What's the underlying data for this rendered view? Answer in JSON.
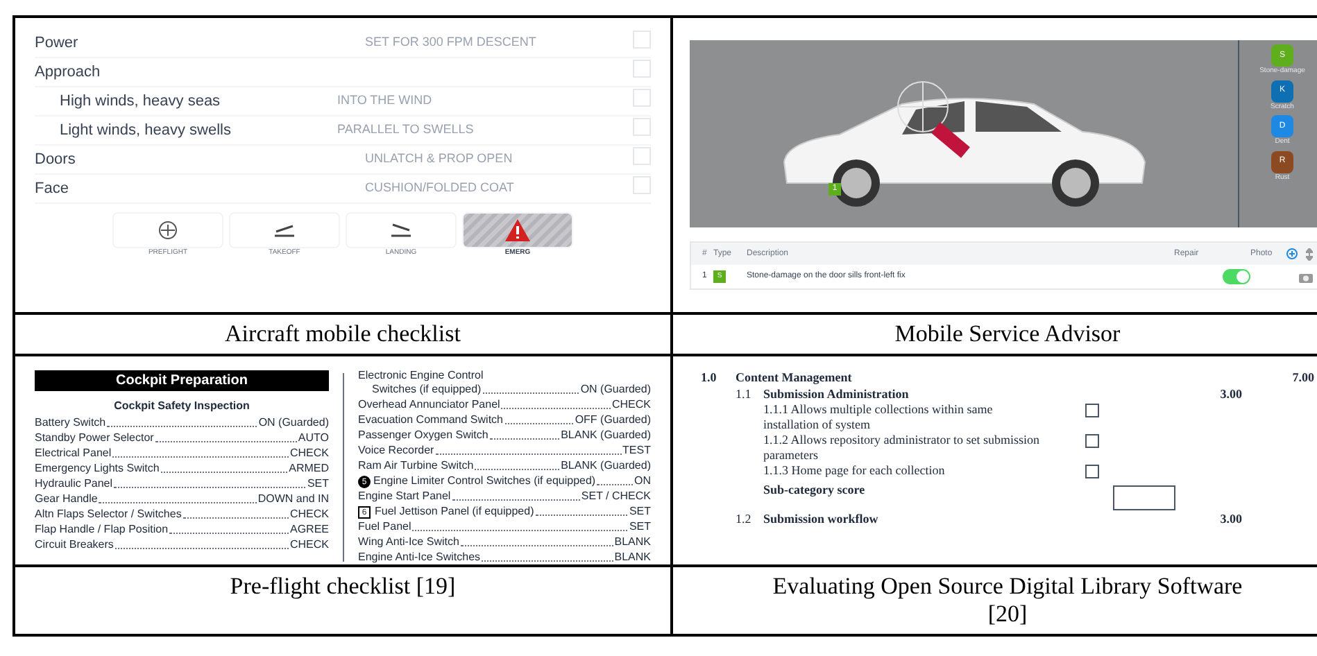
{
  "panels": [
    {
      "kind": "aircraft",
      "caption": "Aircraft mobile checklist",
      "items": [
        {
          "label": "Power",
          "value": "SET FOR 300 FPM DESCENT",
          "checked": false
        },
        {
          "label": "Approach",
          "checked": false,
          "children": [
            {
              "label": "High winds, heavy seas",
              "value": "INTO THE WIND",
              "checked": false
            },
            {
              "label": "Light winds, heavy swells",
              "value": "PARALLEL TO SWELLS",
              "checked": false
            }
          ]
        },
        {
          "label": "Doors",
          "value": "UNLATCH & PROP OPEN",
          "checked": false
        },
        {
          "label": "Face",
          "value": "CUSHION/FOLDED COAT",
          "checked": false
        }
      ],
      "tabs": [
        {
          "label": "PREFLIGHT",
          "kind": "preflight",
          "selected": false
        },
        {
          "label": "TAKEOFF",
          "kind": "takeoff",
          "selected": false
        },
        {
          "label": "LANDING",
          "kind": "landing",
          "selected": false
        },
        {
          "label": "EMERG",
          "kind": "emergency",
          "selected": true
        }
      ]
    },
    {
      "kind": "service",
      "caption": "Mobile Service Advisor",
      "legend": [
        {
          "letter": "S",
          "label": "Stone-damage",
          "color": "#5fae1e"
        },
        {
          "letter": "K",
          "label": "Scratch",
          "color": "#0e6fb3"
        },
        {
          "letter": "D",
          "label": "Dent",
          "color": "#1e88e5"
        },
        {
          "letter": "R",
          "label": "Rust",
          "color": "#8b4a22"
        }
      ],
      "pin": "1",
      "columns": [
        "#",
        "Type",
        "Description",
        "Repair",
        "Photo"
      ],
      "rows": [
        {
          "number": "1",
          "type": "S",
          "color": "#5fae1e",
          "description": "Stone-damage on the door sills front-left fix",
          "repair": true
        }
      ]
    },
    {
      "kind": "printed",
      "caption": "Pre-flight checklist [19]",
      "banner": "Cockpit Preparation",
      "subtitle": "Cockpit Safety Inspection",
      "left": [
        {
          "label": "Battery Switch",
          "value": "ON (Guarded)"
        },
        {
          "label": "Standby Power Selector",
          "value": "AUTO"
        },
        {
          "label": "Electrical Panel",
          "value": "CHECK"
        },
        {
          "label": "Emergency Lights Switch",
          "value": "ARMED"
        },
        {
          "label": "Hydraulic Panel",
          "value": "SET"
        },
        {
          "label": "Gear Handle",
          "value": "DOWN and IN"
        },
        {
          "label": "Altn Flaps Selector / Switches",
          "value": "CHECK"
        },
        {
          "label": "Flap Handle / Flap Position",
          "value": "AGREE"
        },
        {
          "label": "Circuit Breakers",
          "value": "CHECK"
        }
      ],
      "right_heading": "Electronic Engine Control",
      "right": [
        {
          "label": "Switches (if equipped)",
          "value": "ON (Guarded)",
          "indent": true
        },
        {
          "label": "Overhead Annunciator Panel",
          "value": "CHECK"
        },
        {
          "label": "Evacuation Command Switch",
          "value": "OFF (Guarded)"
        },
        {
          "label": "Passenger Oxygen Switch",
          "value": "BLANK (Guarded)"
        },
        {
          "label": "Voice Recorder",
          "value": "TEST"
        },
        {
          "label": "Ram Air Turbine Switch",
          "value": "BLANK (Guarded)"
        },
        {
          "label": "Engine Limiter Control Switches (if equipped)",
          "value": "ON",
          "marker": {
            "kind": "circle",
            "text": "5"
          }
        },
        {
          "label": "Engine Start Panel",
          "value": "SET / CHECK"
        },
        {
          "label": "Fuel Jettison Panel (if equipped)",
          "value": "SET",
          "marker": {
            "kind": "square",
            "text": "6"
          }
        },
        {
          "label": "Fuel Panel",
          "value": "SET"
        },
        {
          "label": "Wing Anti-Ice Switch",
          "value": "BLANK"
        },
        {
          "label": "Engine Anti-Ice Switches",
          "value": "BLANK"
        }
      ]
    },
    {
      "kind": "form",
      "caption": "Evaluating Open Source Digital Library Software [20]",
      "section": {
        "number": "1.0",
        "title": "Content Management",
        "score": "7.00"
      },
      "subsections": [
        {
          "number": "1.1",
          "title": "Submission Administration",
          "score": "3.00",
          "criteria": [
            {
              "text": "1.1.1 Allows multiple collections within same installation of system",
              "checked": false
            },
            {
              "text": "1.1.2 Allows repository administrator to set submission parameters",
              "checked": false
            },
            {
              "text": "1.1.3 Home page for each collection",
              "checked": false
            }
          ],
          "subtotal": "Sub-category score"
        },
        {
          "number": "1.2",
          "title": "Submission workflow",
          "score": "3.00"
        }
      ]
    }
  ]
}
